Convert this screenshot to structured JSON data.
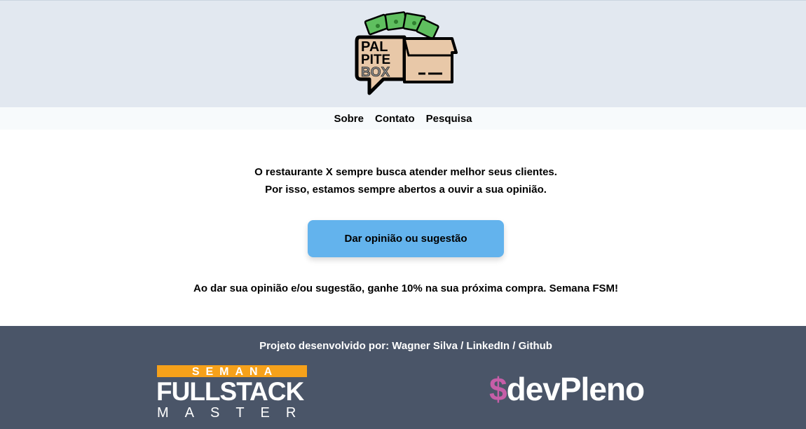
{
  "header": {
    "logo": {
      "lines": [
        "PAL",
        "PITE",
        "BOX"
      ],
      "colors": {
        "money": "#5fbf5f",
        "box": "#e8c8a8",
        "outline": "#000000",
        "box_word": "#888888"
      }
    }
  },
  "nav": {
    "items": [
      "Sobre",
      "Contato",
      "Pesquisa"
    ]
  },
  "main": {
    "intro_line1": "O restaurante X sempre busca atender melhor seus clientes.",
    "intro_line2": "Por isso, estamos sempre abertos a ouvir a sua opinião.",
    "cta_label": "Dar opinião ou sugestão",
    "promo": "Ao dar sua opinião e/ou sugestão, ganhe 10% na sua próxima compra. Semana FSM!"
  },
  "footer": {
    "credits_prefix": "Projeto desenvolvido por: ",
    "author": "Wagner Silva",
    "separator": " / ",
    "linkedin": "LinkedIn",
    "github": "Github",
    "fsm_logo": {
      "top": "SEMANA",
      "middle": "FULLSTACK",
      "bottom": "MASTER"
    },
    "devpleno_logo": {
      "dollar": "$",
      "text": "devPleno"
    }
  },
  "colors": {
    "header_bg": "#e2e8f0",
    "nav_bg": "#f7fafc",
    "cta_bg": "#63b3ed",
    "footer_bg": "#4a5568",
    "fsm_orange": "#f6a11a",
    "devpleno_pink": "#c65ea8"
  }
}
